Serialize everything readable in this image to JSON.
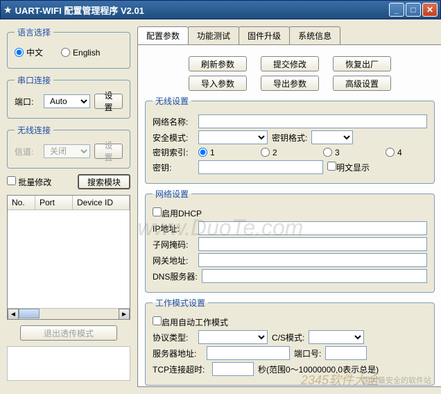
{
  "window": {
    "title": "UART-WIFI 配置管理程序  V2.01"
  },
  "left": {
    "lang_group": "语言选择",
    "lang_cn": "中文",
    "lang_en": "English",
    "serial_group": "串口连接",
    "port_label": "端口:",
    "port_value": "Auto",
    "set_btn": "设置",
    "wireless_group": "无线连接",
    "channel_label": "信道:",
    "channel_value": "关闭",
    "batch_label": "批量修改",
    "search_btn": "搜索模块",
    "col_no": "No.",
    "col_port": "Port",
    "col_device": "Device ID",
    "exit_btn": "退出透传模式"
  },
  "tabs": {
    "t1": "配置参数",
    "t2": "功能测试",
    "t3": "固件升级",
    "t4": "系统信息"
  },
  "buttons": {
    "refresh": "刷新参数",
    "submit": "提交修改",
    "restore": "恢复出厂",
    "import": "导入参数",
    "export": "导出参数",
    "advanced": "高级设置"
  },
  "wireless": {
    "group": "无线设置",
    "ssid": "网络名称:",
    "security": "安全模式:",
    "keyfmt": "密钥格式:",
    "keyidx": "密钥索引:",
    "r1": "1",
    "r2": "2",
    "r3": "3",
    "r4": "4",
    "key": "密钥:",
    "plaintext": "明文显示"
  },
  "network": {
    "group": "网络设置",
    "dhcp": "启用DHCP",
    "ip": "IP地址:",
    "mask": "子网掩码:",
    "gateway": "网关地址:",
    "dns": "DNS服务器:"
  },
  "workmode": {
    "group": "工作模式设置",
    "auto": "启用自动工作模式",
    "protocol": "协议类型:",
    "csmode": "C/S模式:",
    "server": "服务器地址:",
    "port": "端口号:",
    "timeout": "TCP连接超时:",
    "timeout_hint": "秒(范围0～10000000,0表示总是)"
  },
  "watermark": {
    "main": "www.DuoTe.com",
    "logo": "2345软件大全",
    "tagline": "国内最安全的软件站"
  }
}
